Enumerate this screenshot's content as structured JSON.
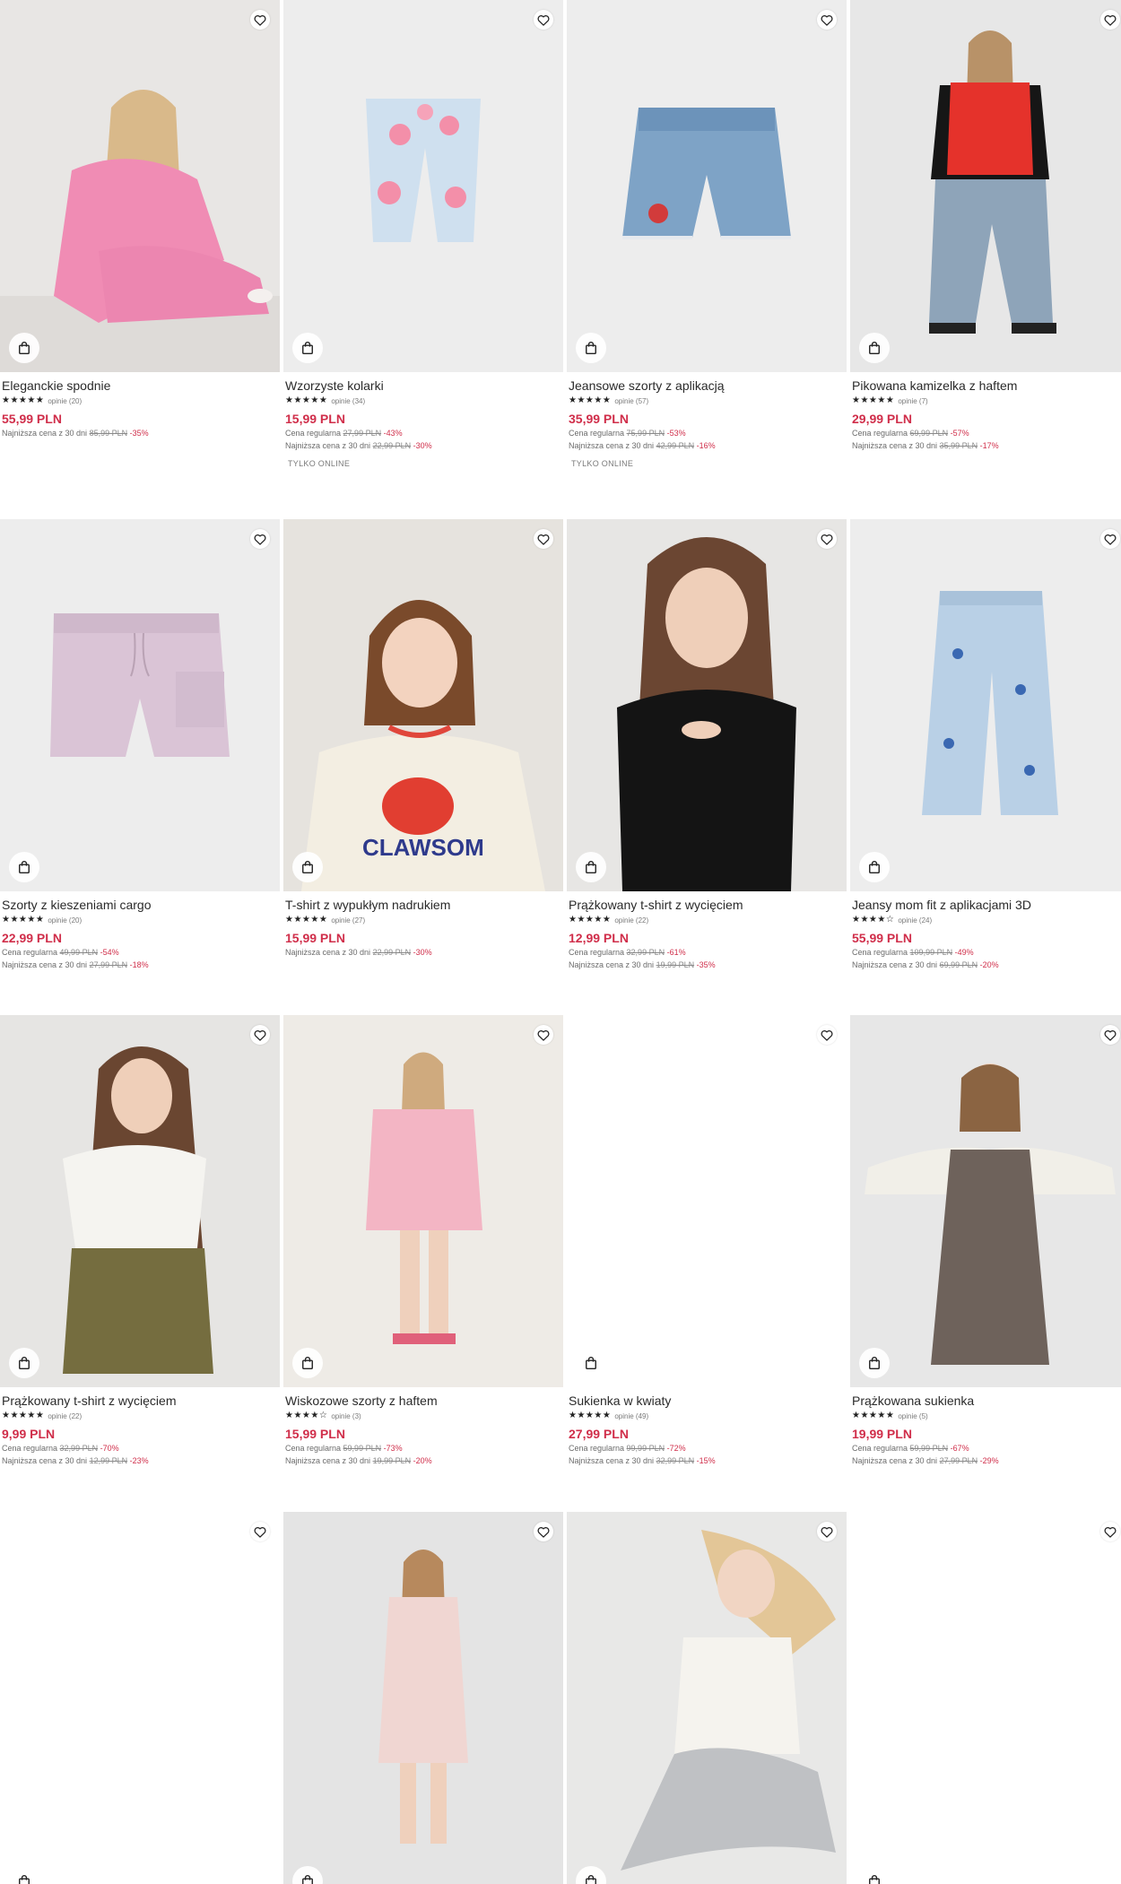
{
  "products": [
    {
      "name": "Eleganckie spodnie",
      "stars": "★★★★★",
      "reviews": "opinie (20)",
      "price": "55,99 PLN",
      "regular": null,
      "lowest": {
        "label": "Najniższa cena z 30 dni",
        "old": "85,99 PLN",
        "pct": "-35%"
      },
      "tag": null,
      "image": "girl-pink-suit"
    },
    {
      "name": "Wzorzyste kolarki",
      "stars": "★★★★★",
      "reviews": "opinie (34)",
      "price": "15,99 PLN",
      "regular": {
        "label": "Cena regularna",
        "old": "27,99 PLN",
        "pct": "-43%"
      },
      "lowest": {
        "label": "Najniższa cena z 30 dni",
        "old": "22,99 PLN",
        "pct": "-30%"
      },
      "tag": "TYLKO ONLINE",
      "image": "bike-shorts"
    },
    {
      "name": "Jeansowe szorty z aplikacją",
      "stars": "★★★★★",
      "reviews": "opinie (57)",
      "price": "35,99 PLN",
      "regular": {
        "label": "Cena regularna",
        "old": "75,99 PLN",
        "pct": "-53%"
      },
      "lowest": {
        "label": "Najniższa cena z 30 dni",
        "old": "42,99 PLN",
        "pct": "-16%"
      },
      "tag": "TYLKO ONLINE",
      "image": "denim-shorts"
    },
    {
      "name": "Pikowana kamizelka z haftem",
      "stars": "★★★★★",
      "reviews": "opinie (7)",
      "price": "29,99 PLN",
      "regular": {
        "label": "Cena regularna",
        "old": "69,99 PLN",
        "pct": "-57%"
      },
      "lowest": {
        "label": "Najniższa cena z 30 dni",
        "old": "35,99 PLN",
        "pct": "-17%"
      },
      "tag": null,
      "image": "girl-red-vest"
    },
    {
      "name": "Szorty z kieszeniami cargo",
      "stars": "★★★★★",
      "reviews": "opinie (20)",
      "price": "22,99 PLN",
      "regular": {
        "label": "Cena regularna",
        "old": "49,99 PLN",
        "pct": "-54%"
      },
      "lowest": {
        "label": "Najniższa cena z 30 dni",
        "old": "27,99 PLN",
        "pct": "-18%"
      },
      "tag": null,
      "image": "cargo-shorts"
    },
    {
      "name": "T-shirt z wypukłym nadrukiem",
      "stars": "★★★★★",
      "reviews": "opinie (27)",
      "price": "15,99 PLN",
      "regular": null,
      "lowest": {
        "label": "Najniższa cena z 30 dni",
        "old": "22,99 PLN",
        "pct": "-30%"
      },
      "tag": null,
      "image": "girl-crab-tee"
    },
    {
      "name": "Prążkowany t-shirt z wycięciem",
      "stars": "★★★★★",
      "reviews": "opinie (22)",
      "price": "12,99 PLN",
      "regular": {
        "label": "Cena regularna",
        "old": "32,99 PLN",
        "pct": "-61%"
      },
      "lowest": {
        "label": "Najniższa cena z 30 dni",
        "old": "19,99 PLN",
        "pct": "-35%"
      },
      "tag": null,
      "image": "girl-black-tee"
    },
    {
      "name": "Jeansy mom fit z aplikacjami 3D",
      "stars": "★★★★☆",
      "reviews": "opinie (24)",
      "price": "55,99 PLN",
      "regular": {
        "label": "Cena regularna",
        "old": "109,99 PLN",
        "pct": "-49%"
      },
      "lowest": {
        "label": "Najniższa cena z 30 dni",
        "old": "69,99 PLN",
        "pct": "-20%"
      },
      "tag": null,
      "image": "mom-jeans"
    },
    {
      "name": "Prążkowany t-shirt z wycięciem",
      "stars": "★★★★★",
      "reviews": "opinie (22)",
      "price": "9,99 PLN",
      "regular": {
        "label": "Cena regularna",
        "old": "32,99 PLN",
        "pct": "-70%"
      },
      "lowest": {
        "label": "Najniższa cena z 30 dni",
        "old": "12,99 PLN",
        "pct": "-23%"
      },
      "tag": null,
      "image": "girl-white-tee"
    },
    {
      "name": "Wiskozowe szorty z haftem",
      "stars": "★★★★☆",
      "reviews": "opinie (3)",
      "price": "15,99 PLN",
      "regular": {
        "label": "Cena regularna",
        "old": "59,99 PLN",
        "pct": "-73%"
      },
      "lowest": {
        "label": "Najniższa cena z 30 dni",
        "old": "19,99 PLN",
        "pct": "-20%"
      },
      "tag": null,
      "image": "girl-pink-set"
    },
    {
      "name": "Sukienka w kwiaty",
      "stars": "★★★★★",
      "reviews": "opinie (49)",
      "price": "27,99 PLN",
      "regular": {
        "label": "Cena regularna",
        "old": "99,99 PLN",
        "pct": "-72%"
      },
      "lowest": {
        "label": "Najniższa cena z 30 dni",
        "old": "32,99 PLN",
        "pct": "-15%"
      },
      "tag": null,
      "image": "blank"
    },
    {
      "name": "Prążkowana sukienka",
      "stars": "★★★★★",
      "reviews": "opinie (5)",
      "price": "19,99 PLN",
      "regular": {
        "label": "Cena regularna",
        "old": "59,99 PLN",
        "pct": "-67%"
      },
      "lowest": {
        "label": "Najniższa cena z 30 dni",
        "old": "27,99 PLN",
        "pct": "-29%"
      },
      "tag": null,
      "image": "girl-brown-dress"
    },
    {
      "name": null,
      "image": "blank"
    },
    {
      "name": null,
      "image": "girl-pink-dress"
    },
    {
      "name": null,
      "image": "girl-skirt"
    },
    {
      "name": null,
      "image": "blank"
    }
  ],
  "icons": {
    "favorite": "heart-icon",
    "cart": "shopping-bag-icon"
  }
}
